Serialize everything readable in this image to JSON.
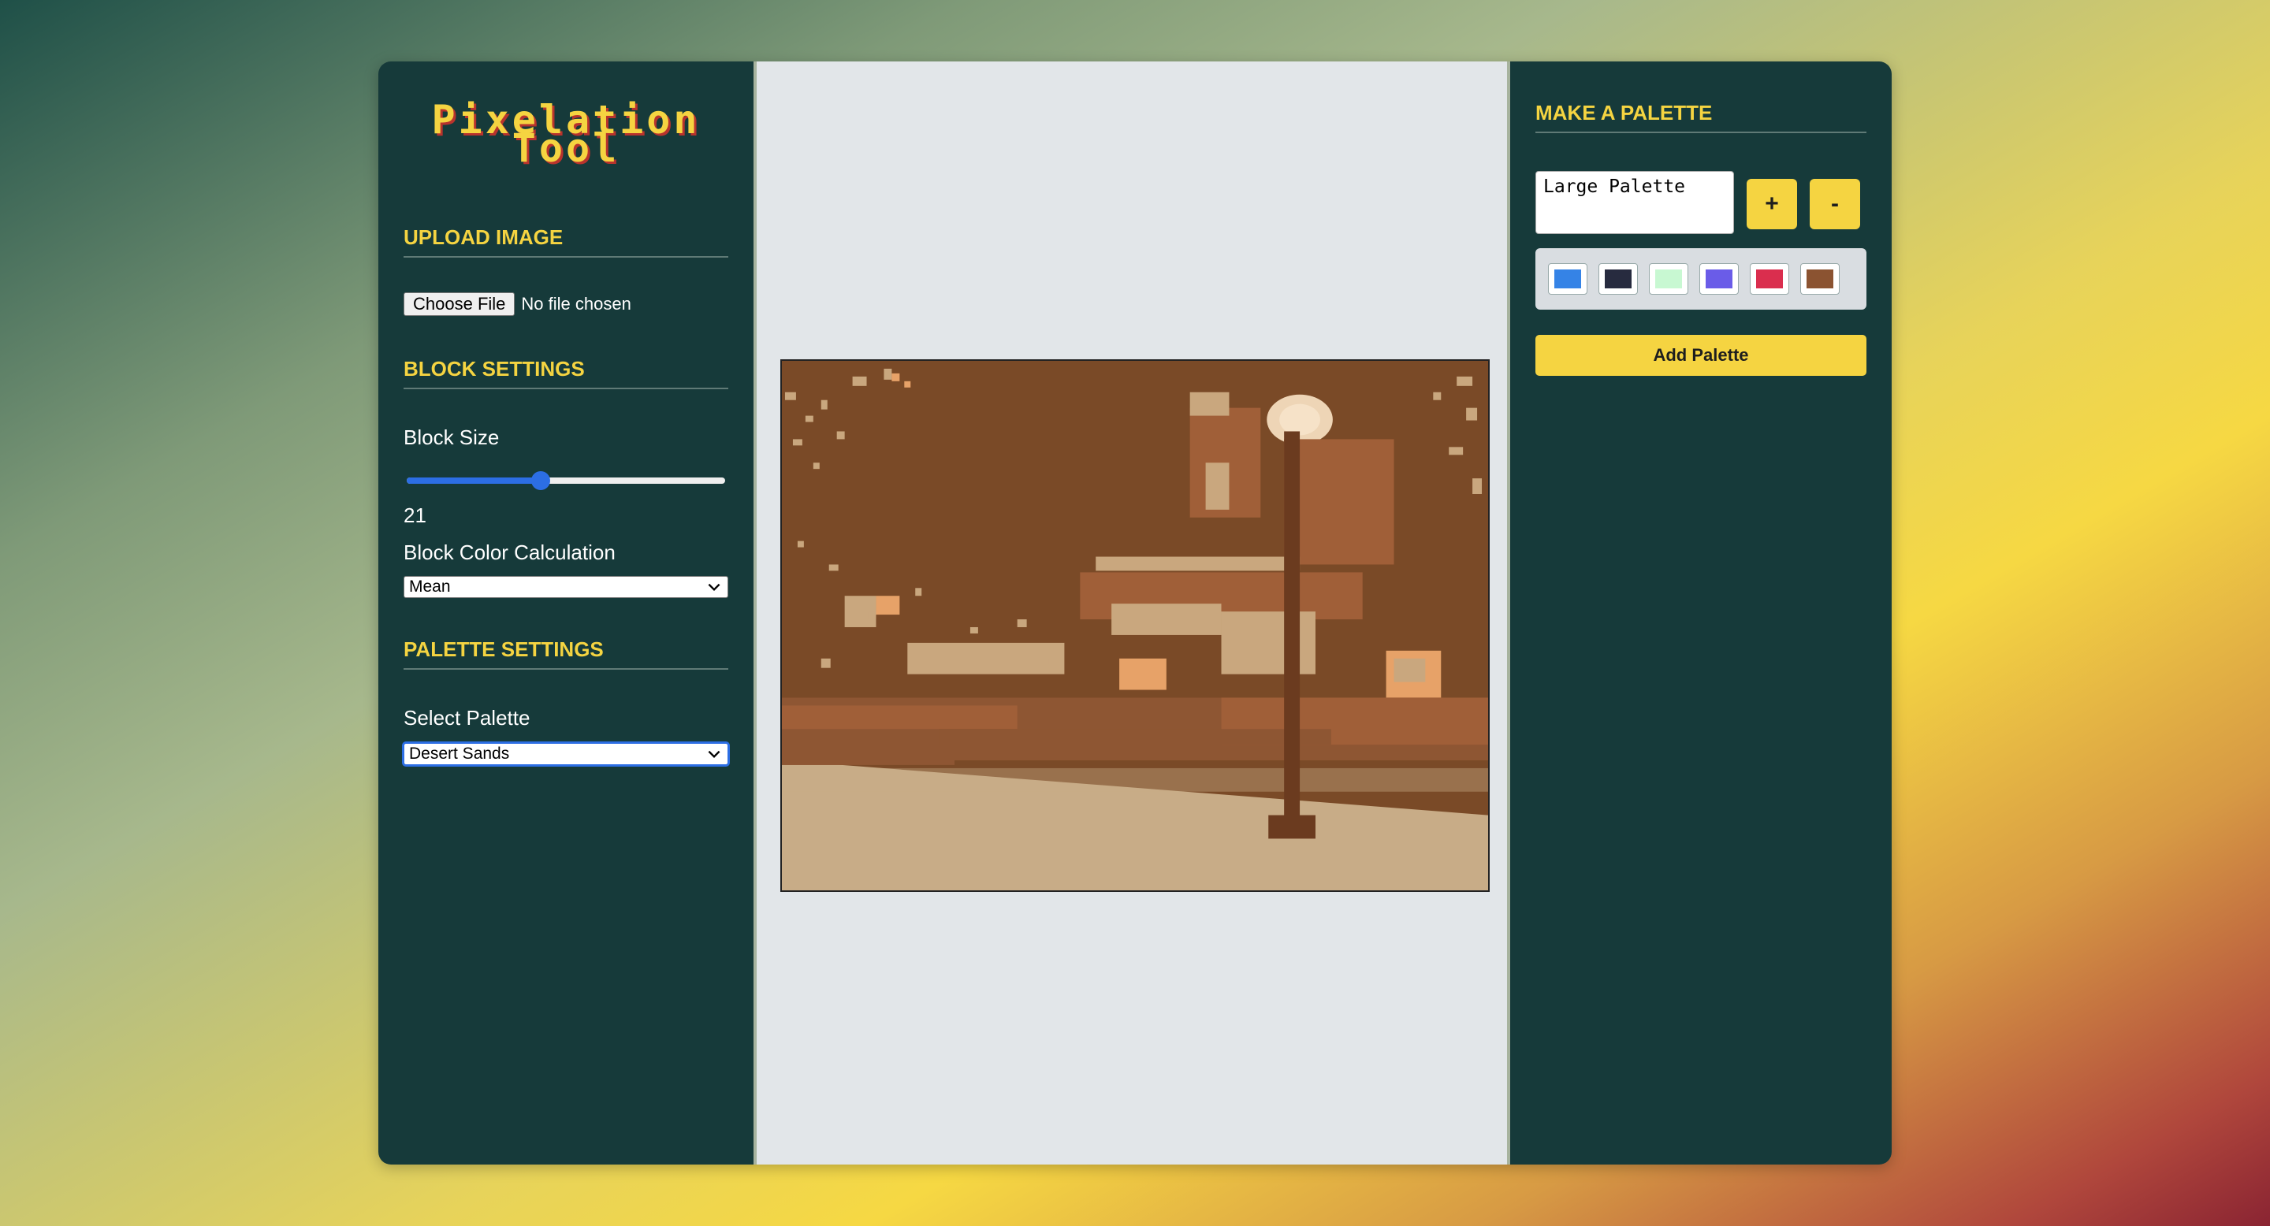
{
  "app": {
    "title_line1": "Pixelation",
    "title_line2": "Tool"
  },
  "upload": {
    "section_title": "UPLOAD IMAGE",
    "choose_file_label": "Choose File",
    "file_status": "No file chosen"
  },
  "block_settings": {
    "section_title": "BLOCK SETTINGS",
    "block_size_label": "Block Size",
    "block_size_value": "21",
    "block_size_fraction": 0.42,
    "color_calc_label": "Block Color Calculation",
    "color_calc_selected": "Mean"
  },
  "palette_settings": {
    "section_title": "PALETTE SETTINGS",
    "select_label": "Select Palette",
    "selected_palette": "Desert Sands"
  },
  "make_palette": {
    "section_title": "MAKE A PALETTE",
    "name_value": "Large Palette",
    "plus_label": "+",
    "minus_label": "-",
    "swatches": [
      "#3583e6",
      "#272b3f",
      "#c8f8d2",
      "#6a5ce8",
      "#da2e4e",
      "#8b5331"
    ],
    "add_button_label": "Add Palette"
  },
  "colors": {
    "accent": "#f5d441",
    "panel": "#163a3a",
    "slider": "#2c6ee4"
  }
}
